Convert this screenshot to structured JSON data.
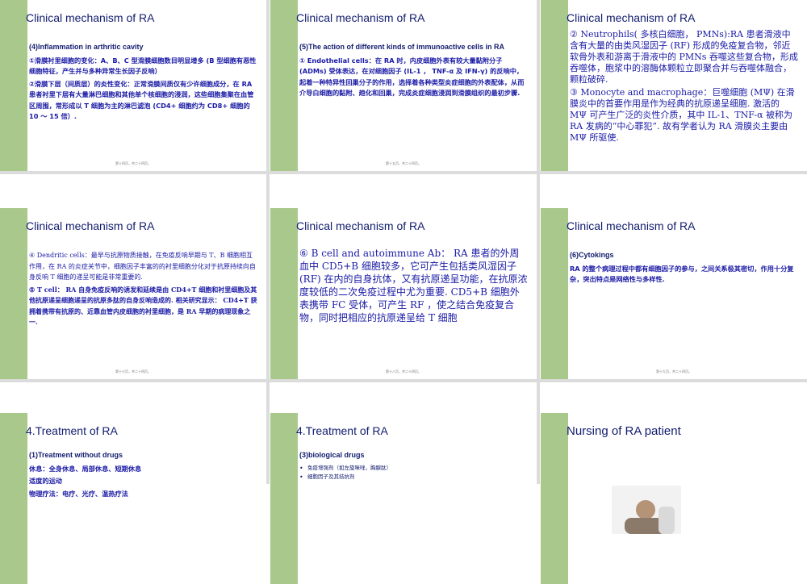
{
  "slides": [
    {
      "title": "Clinical mechanism of RA",
      "heading": "(4)Inflammation in arthritic cavity",
      "paras": [
        "①滑膜衬里细胞的变化：A、B、C 型滑膜细胞数目明显增多 (B 型细胞有恶性细胞特征，产生并与多种异常生长因子反响）",
        "②滑膜下层（间质层）的炎性变化：正常滑膜间质仅有少许细胞成分，在 RA 患者衬里下层有大量淋巴细胞和其他单个核细胞的浸润，这些细胞集聚在血管区周围，常形成以 T 细胞为主的淋巴滤泡 (CD4+ 细胞约为 CD8+ 细胞的 10 ～ 15 倍）."
      ],
      "footer": "第十四页，共二十四页。"
    },
    {
      "title": "Clinical mechanism of RA",
      "heading": "(5)The action of different kinds of immunoactive cells in RA",
      "paras": [
        "① Endothelial cells：在 RA 时，内皮细胞外表有较大量黏附分子 (ADMs) 受体表达，在对细胞因子 (IL-1 ， TNF-α 及 IFN-γ) 的反响中，起着一种特异性回巢分子的作用，选择着各种类型炎症细胞的外表配体，从而介导白细胞的黏附、趋化和回巢，完成炎症细胞浸润到滑膜组织的最初步骤."
      ],
      "footer": "第十五页，共二十四页。"
    },
    {
      "title": "Clinical mechanism of RA",
      "paras": [
        "② Neutrophils( 多核白细胞， PMNs):RA 患者滑液中含有大量的由类风湿因子 (RF) 形成的免疫复合物，邻近软骨外表和游离于滑液中的 PMNs 吞噬这些复合物，形成吞噬体，胞浆中的溶酶体颗粒立即聚合并与吞噬体融合，颗粒破碎.",
        "③ Monocyte and macrophage：巨噬细胞 (MΨ) 在滑膜炎中的首要作用是作为经典的抗原递呈细胞. 激活的 MΨ 可产生广泛的炎性介质，其中 IL-1、TNF-α 被称为 RA 发病的“中心罪犯”. 故有学者认为 RA 滑膜炎主要由 MΨ 所驱使."
      ],
      "footer": ""
    },
    {
      "title": "Clinical mechanism of RA",
      "paras": [
        "④ Dendritic cells：最早与抗原物质接触，在免疫反响早期与 T、B 细胞相互作用，在 RA 的炎症关节中，细胞因子丰富的的衬里细胞分化对于抗原持续向自身反响 T 细胞的递呈可能是非常重要的.",
        "⑤ T cell： RA 自身免疫反响的诱发和延续是由 CD4+T 细胞和衬里细胞及其他抗原递呈细胞递呈的抗原多肽的自身反响造成的. 相关研究显示： CD4+T 获拥着携带有抗原的、近靠血管内皮细胞的衬里细胞，是 RA 早期的病理现象之一."
      ],
      "footer": "第十七页，共二十四页。"
    },
    {
      "title": "Clinical mechanism of RA",
      "paras": [
        "⑥ B cell and autoimmune Ab： RA 患者的外周血中 CD5+B 细胞较多，它可产生包括类风湿因子 (RF) 在内的自身抗体，又有抗原递呈功能，在抗原浓度较低的二次免疫过程中尤为重要. CD5+B 细胞外表携带 FC 受体，可产生 RF ，使之结合免疫复合物，同时把相应的抗原递呈给 T 细胞"
      ],
      "footer": "第十八页，共二十四页。"
    },
    {
      "title": "Clinical mechanism of RA",
      "heading": "(6)Cytokings",
      "paras": [
        "RA 的整个病理过程中都有细胞因子的参与，之间关系极其密切，作用十分复杂，突出特点是网络性与多样性."
      ],
      "footer": "第十九页，共二十四页。"
    },
    {
      "title": "4.Treatment of RA",
      "heading": "(1)Treatment without drugs",
      "paras": [
        "休息：全身休息、局部休息、短期休息",
        "适度的运动",
        "物理疗法：电疗、光疗、温热疗法"
      ],
      "footer": ""
    },
    {
      "title": "4.Treatment of RA",
      "heading": "(3)biological drugs",
      "bullets": [
        "免疫增强剂（如左旋咪唑，胸腺肽）",
        "细胞因子及其拮抗剂"
      ],
      "footer": ""
    },
    {
      "title": "Nursing of RA patient",
      "footer": ""
    }
  ]
}
